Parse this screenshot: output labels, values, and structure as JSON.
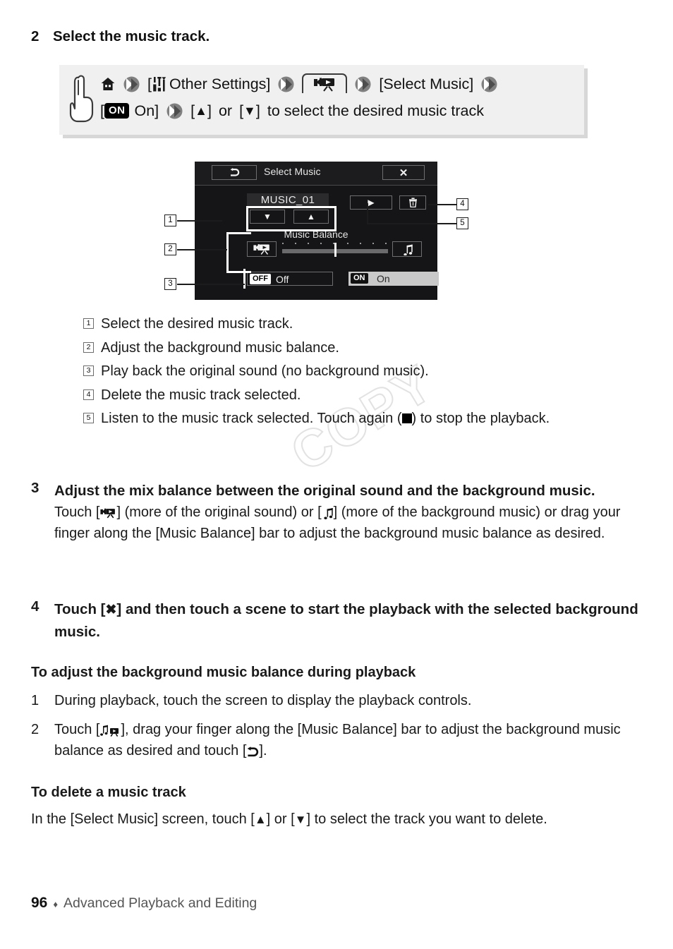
{
  "page": {
    "number": "96",
    "separator": "♦",
    "chapter": "Advanced Playback and Editing",
    "watermark": "COPY"
  },
  "step2": {
    "number": "2",
    "heading": "Select the music track."
  },
  "instruction_box": {
    "icons": {
      "hand": "pointing-hand-icon",
      "home": "home-icon",
      "arrow": "double-chevron-icon",
      "tools": "tools-icon",
      "camcorder": "camcorder-icon",
      "up": "▲",
      "down": "▼"
    },
    "line1": {
      "open_bracket": "[",
      "other_settings": "Other Settings]",
      "select_music": "[Select Music]"
    },
    "line2": {
      "open_bracket": "[",
      "on_badge": "ON",
      "on_label": "On]",
      "up_bracket_open": "[",
      "up_arrow": "▲",
      "up_bracket_close": "]",
      "or": "or",
      "down_bracket_open": "[",
      "down_arrow": "▼",
      "down_bracket_close": "]",
      "tail": "to select the desired music track"
    }
  },
  "camera_screen": {
    "back_icon": "back-arrow-icon",
    "title": "Select Music",
    "close_icon": "✕",
    "track_name": "MUSIC_01",
    "down_arrow": "▼",
    "up_arrow": "▲",
    "play_icon": "▶",
    "delete_icon": "trash-icon",
    "balance_label": "Music Balance",
    "original_sound_icon": "camcorder-icon",
    "music_icon": "music-note-icon",
    "off": {
      "badge": "OFF",
      "label": "Off"
    },
    "on": {
      "badge": "ON",
      "label": "On"
    }
  },
  "callouts": [
    "1",
    "2",
    "3",
    "4",
    "5"
  ],
  "explanations": [
    {
      "key": "1",
      "text": "Select the desired music track."
    },
    {
      "key": "2",
      "text": "Adjust the background music balance."
    },
    {
      "key": "3",
      "text": "Play back the original sound (no background music)."
    },
    {
      "key": "4",
      "text": "Delete the music track selected."
    },
    {
      "key": "5",
      "text_before": "Listen to the music track selected. Touch again (",
      "text_after": ") to stop the playback."
    }
  ],
  "step3": {
    "number": "3",
    "heading": "Adjust the mix balance between the original sound and the background music.",
    "body_part1": "Touch [",
    "body_part2": "] (more of the original sound) or [",
    "body_part3": "] (more of the background music) or drag your finger along the [Music Balance] bar to adjust the background music balance as desired."
  },
  "step4": {
    "number": "4",
    "heading_part1": "Touch [",
    "heading_icon": "✖",
    "heading_part2": "] and then touch a scene to start the playback with the selected background music."
  },
  "section_balance": {
    "title": "To adjust the background music balance during playback",
    "items": [
      {
        "num": "1",
        "text": "During playback, touch the screen to display the playback controls."
      },
      {
        "num": "2",
        "part1": "Touch [",
        "part2": "], drag your finger along the [Music Balance] bar to adjust the background music balance as desired and touch [",
        "part3": "]."
      }
    ]
  },
  "section_delete": {
    "title": "To delete a music track",
    "part1": "In the [Select Music] screen, touch [",
    "up_arrow": "▲",
    "part2": "] or [",
    "down_arrow": "▼",
    "part3": "] to select the track you want to delete."
  }
}
